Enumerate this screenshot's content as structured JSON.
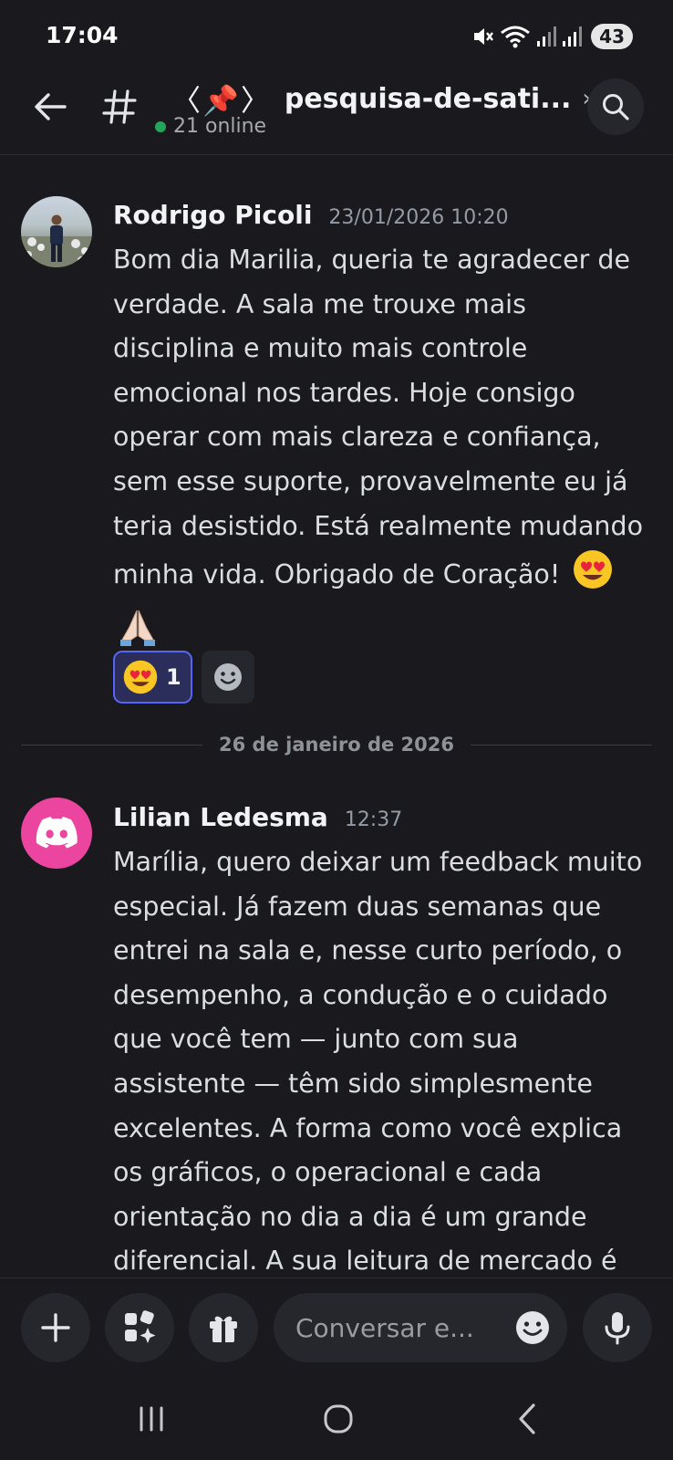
{
  "status_bar": {
    "time": "17:04",
    "battery": "43"
  },
  "header": {
    "channel_prefix": "〈📌〉",
    "channel_name": "pesquisa-de-sati...",
    "online_text": "21 online",
    "online_color": "#23a55a"
  },
  "messages": [
    {
      "author": "Rodrigo Picoli",
      "timestamp": "23/01/2026 10:20",
      "text": "Bom dia Marilia, queria te agradecer de verdade. A sala me trouxe mais disciplina e muito mais controle emocional nos tardes. Hoje consigo operar com mais clareza e confiança, sem esse suporte, provavelmente eu já teria desistido. Está realmente mudando minha vida. Obrigado de Coração!",
      "emojis": [
        "heart-eyes-emoji",
        "praying-hands-emoji"
      ],
      "reactions": [
        {
          "emoji": "heart-eyes-emoji",
          "count": "1"
        }
      ]
    },
    {
      "author": "Lilian Ledesma",
      "timestamp": "12:37",
      "text": "Marília, quero deixar um feedback muito especial. Já fazem duas semanas que entrei na sala e, nesse curto período, o desempenho, a condução e o cuidado que você tem — junto com sua assistente — têm sido simplesmente excelentes. A forma como você explica os gráficos, o operacional e cada orientação no dia a dia é um grande diferencial. A sua leitura de mercado é",
      "avatar": "discord-logo-icon"
    }
  ],
  "date_divider": "26 de janeiro de 2026",
  "composer": {
    "placeholder": "Conversar e..."
  },
  "colors": {
    "background": "#1a1a1e",
    "accent": "#5865f2",
    "discord_pink": "#eb459f"
  }
}
